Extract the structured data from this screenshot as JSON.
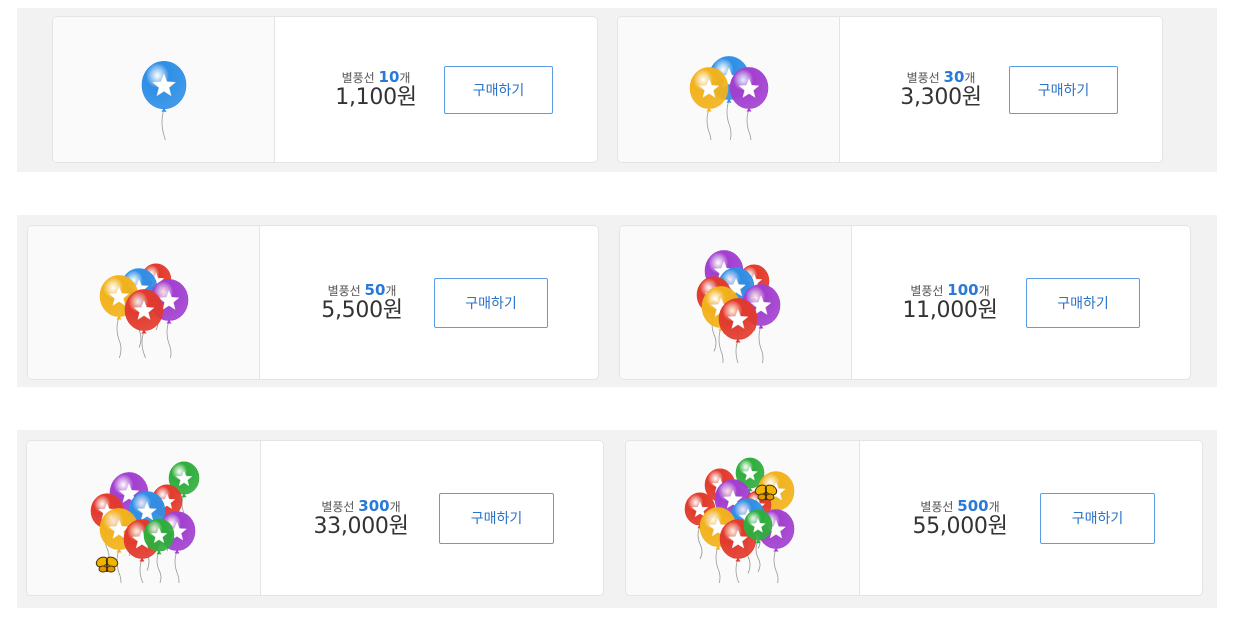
{
  "products": [
    {
      "prefix": "별풍선",
      "count": "10",
      "unit": "개",
      "price": "1,100원",
      "button": "구매하기",
      "icon": "single-balloon-icon"
    },
    {
      "prefix": "별풍선",
      "count": "30",
      "unit": "개",
      "price": "3,300원",
      "button": "구매하기",
      "icon": "balloon-bunch-3-icon"
    },
    {
      "prefix": "별풍선",
      "count": "50",
      "unit": "개",
      "price": "5,500원",
      "button": "구매하기",
      "icon": "balloon-bunch-5-icon"
    },
    {
      "prefix": "별풍선",
      "count": "100",
      "unit": "개",
      "price": "11,000원",
      "button": "구매하기",
      "icon": "balloon-bunch-7-icon"
    },
    {
      "prefix": "별풍선",
      "count": "300",
      "unit": "개",
      "price": "33,000원",
      "button": "구매하기",
      "icon": "balloon-bunch-9-butterfly-icon"
    },
    {
      "prefix": "별풍선",
      "count": "500",
      "unit": "개",
      "price": "55,000원",
      "button": "구매하기",
      "icon": "balloon-bunch-11-butterfly-icon"
    }
  ],
  "colors": {
    "accent": "#2979d8",
    "button_border": "#5b9ee8",
    "balloon_blue": "#2f8fe6",
    "balloon_yellow": "#f2b21b",
    "balloon_purple": "#a23fd0",
    "balloon_red": "#e23a2c",
    "balloon_green": "#2fae3c"
  }
}
